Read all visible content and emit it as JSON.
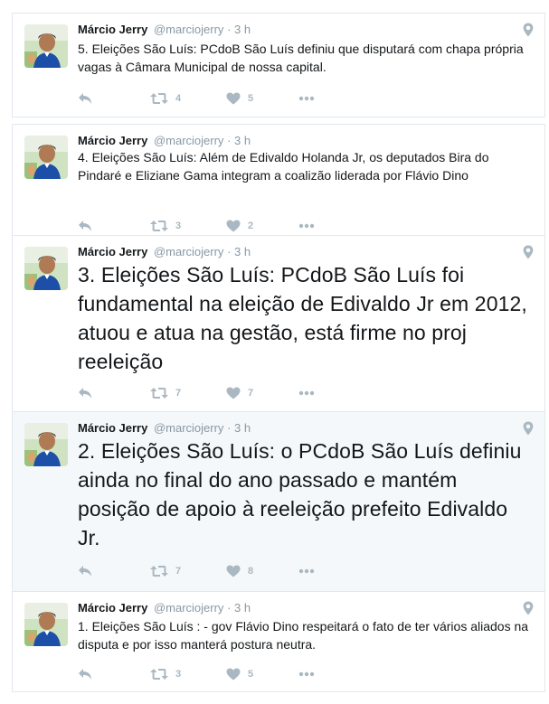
{
  "tweets": [
    {
      "name": "Márcio Jerry",
      "handle": "@marciojerry",
      "dot": "·",
      "time": "3 h",
      "text": "5. Eleições São Luís: PCdoB São Luís definiu que disputará com chapa própria vagas à Câmara Municipal de nossa capital.",
      "retweets": "4",
      "likes": "5"
    },
    {
      "name": "Márcio Jerry",
      "handle": "@marciojerry",
      "dot": "·",
      "time": "3 h",
      "text": "4. Eleições São Luís: Além de Edivaldo Holanda Jr, os deputados Bira do Pindaré e Eliziane Gama integram a coalizão liderada por Flávio Dino",
      "retweets": "3",
      "likes": "2"
    },
    {
      "name": "Márcio Jerry",
      "handle": "@marciojerry",
      "dot": "·",
      "time": "3 h",
      "text": "3. Eleições São Luís: PCdoB São Luís foi fundamental na eleição de Edivaldo Jr em 2012, atuou e atua na gestão, está firme no proj reeleição",
      "retweets": "7",
      "likes": "7"
    },
    {
      "name": "Márcio Jerry",
      "handle": "@marciojerry",
      "dot": "·",
      "time": "3 h",
      "text": "2. Eleições São Luís: o PCdoB São Luís definiu ainda no final do ano passado e mantém posição de apoio à reeleição prefeito Edivaldo Jr.",
      "retweets": "7",
      "likes": "8"
    },
    {
      "name": "Márcio Jerry",
      "handle": "@marciojerry",
      "dot": "·",
      "time": "3 h",
      "text": "1. Eleições São Luís : - gov Flávio Dino respeitará o fato de ter vários aliados na disputa e por isso manterá postura neutra.",
      "retweets": "3",
      "likes": "5"
    }
  ],
  "colors": {
    "text": "#14171a",
    "muted": "#8899a6",
    "icon": "#aab8c2",
    "border": "#e1e8ed",
    "highlight_bg": "#f5f8fa"
  },
  "icons": [
    "reply-icon",
    "retweet-icon",
    "heart-icon",
    "more-icon",
    "geo-pin-icon"
  ]
}
